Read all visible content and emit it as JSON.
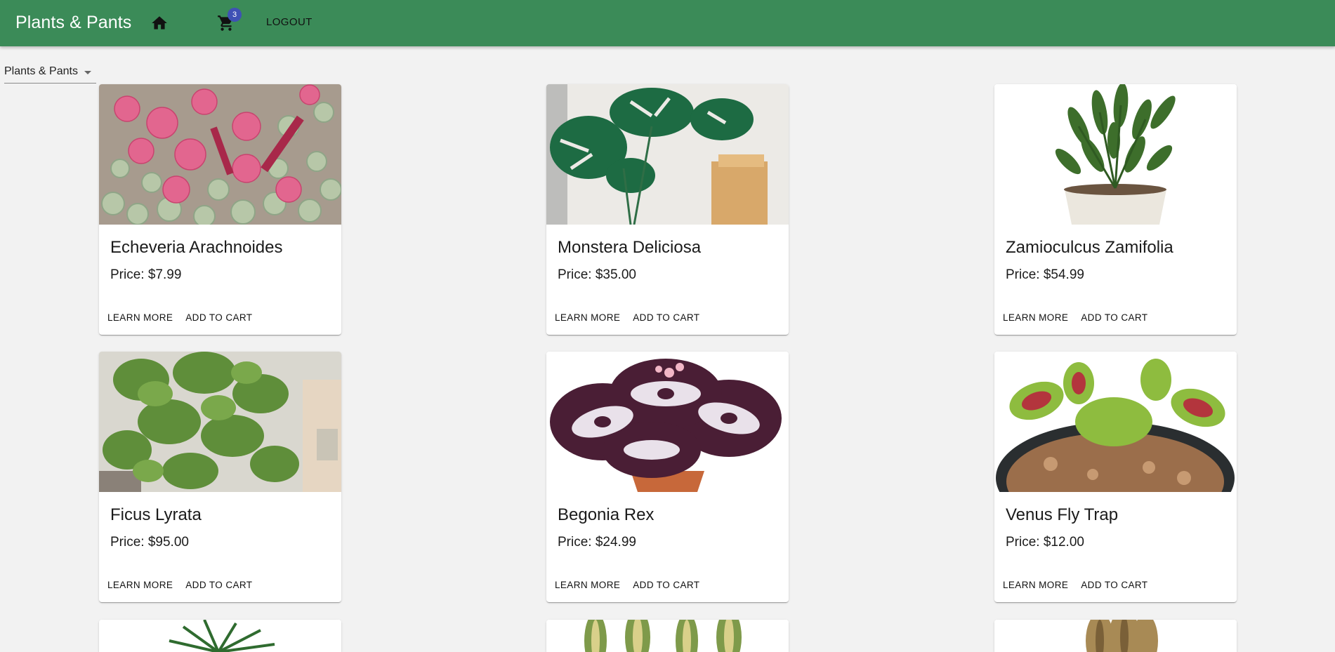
{
  "app": {
    "title": "Plants & Pants",
    "logout_label": "LOGOUT",
    "cart_count": "3",
    "colors": {
      "appbar": "#3b8b58",
      "badge": "#3f51b5",
      "background": "#f2f2f2"
    }
  },
  "filter": {
    "selected": "Plants & Pants"
  },
  "products": [
    {
      "name": "Echeveria Arachnoides",
      "price": "Price: $7.99",
      "learn_more": "LEARN MORE",
      "add_to_cart": "ADD TO CART"
    },
    {
      "name": "Monstera Deliciosa",
      "price": "Price: $35.00",
      "learn_more": "LEARN MORE",
      "add_to_cart": "ADD TO CART"
    },
    {
      "name": "Zamioculcus Zamifolia",
      "price": "Price: $54.99",
      "learn_more": "LEARN MORE",
      "add_to_cart": "ADD TO CART"
    },
    {
      "name": "Ficus Lyrata",
      "price": "Price: $95.00",
      "learn_more": "LEARN MORE",
      "add_to_cart": "ADD TO CART"
    },
    {
      "name": "Begonia Rex",
      "price": "Price: $24.99",
      "learn_more": "LEARN MORE",
      "add_to_cart": "ADD TO CART"
    },
    {
      "name": "Venus Fly Trap",
      "price": "Price: $12.00",
      "learn_more": "LEARN MORE",
      "add_to_cart": "ADD TO CART"
    }
  ]
}
